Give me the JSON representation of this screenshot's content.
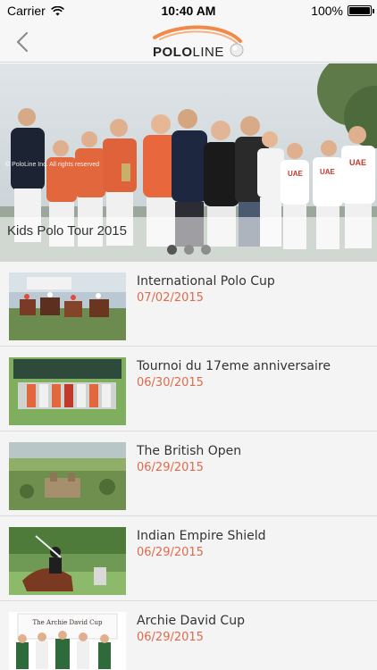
{
  "status_bar": {
    "carrier": "Carrier",
    "time": "10:40 AM",
    "battery": "100%",
    "battery_level": 1.0
  },
  "nav": {
    "logo_text_bold": "POLO",
    "logo_text_light": "LINE"
  },
  "hero": {
    "caption": "Kids Polo Tour 2015",
    "watermark": "© PoloLine Inc. All rights reserved",
    "jersey_text": "UAE",
    "pages": 3,
    "active_page": 0
  },
  "news": [
    {
      "title": "International Polo Cup",
      "date": "07/02/2015"
    },
    {
      "title": "Tournoi du 17eme anniversaire",
      "date": "06/30/2015"
    },
    {
      "title": "The British Open",
      "date": "06/29/2015"
    },
    {
      "title": "Indian Empire Shield",
      "date": "06/29/2015"
    },
    {
      "title": "Archie David Cup",
      "date": "06/29/2015",
      "thumb_sign": "The Archie David Cup"
    }
  ],
  "colors": {
    "date": "#e06a4a",
    "logo_arc": "#f08a4b"
  }
}
